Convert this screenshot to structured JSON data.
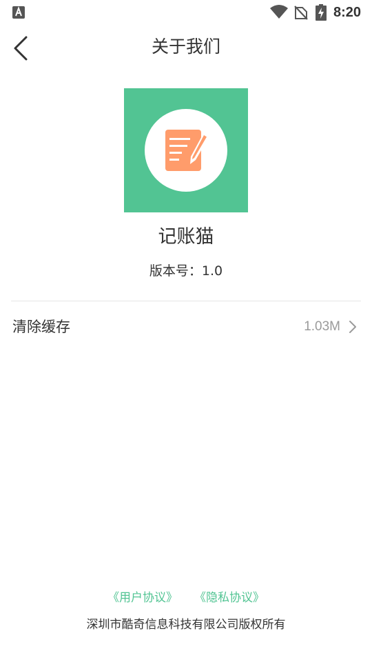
{
  "status_bar": {
    "time": "8:20"
  },
  "header": {
    "title": "关于我们"
  },
  "app": {
    "name": "记账猫",
    "version_label": "版本号：",
    "version_value": "1.0"
  },
  "settings": {
    "clear_cache_label": "清除缓存",
    "cache_size": "1.03M"
  },
  "footer": {
    "user_agreement": "《用户协议》",
    "privacy_policy": "《隐私协议》",
    "copyright": "深圳市酷奇信息科技有限公司版权所有"
  },
  "colors": {
    "accent": "#52c493",
    "logo_note": "#ff9c6b",
    "muted_text": "#9a9a9a"
  },
  "icons": {
    "status_left": "app-notification-icon",
    "wifi": "wifi-icon",
    "signal": "no-signal-icon",
    "battery": "battery-charging-icon",
    "back": "chevron-left-icon",
    "logo": "note-pencil-icon",
    "row_arrow": "chevron-right-icon"
  }
}
